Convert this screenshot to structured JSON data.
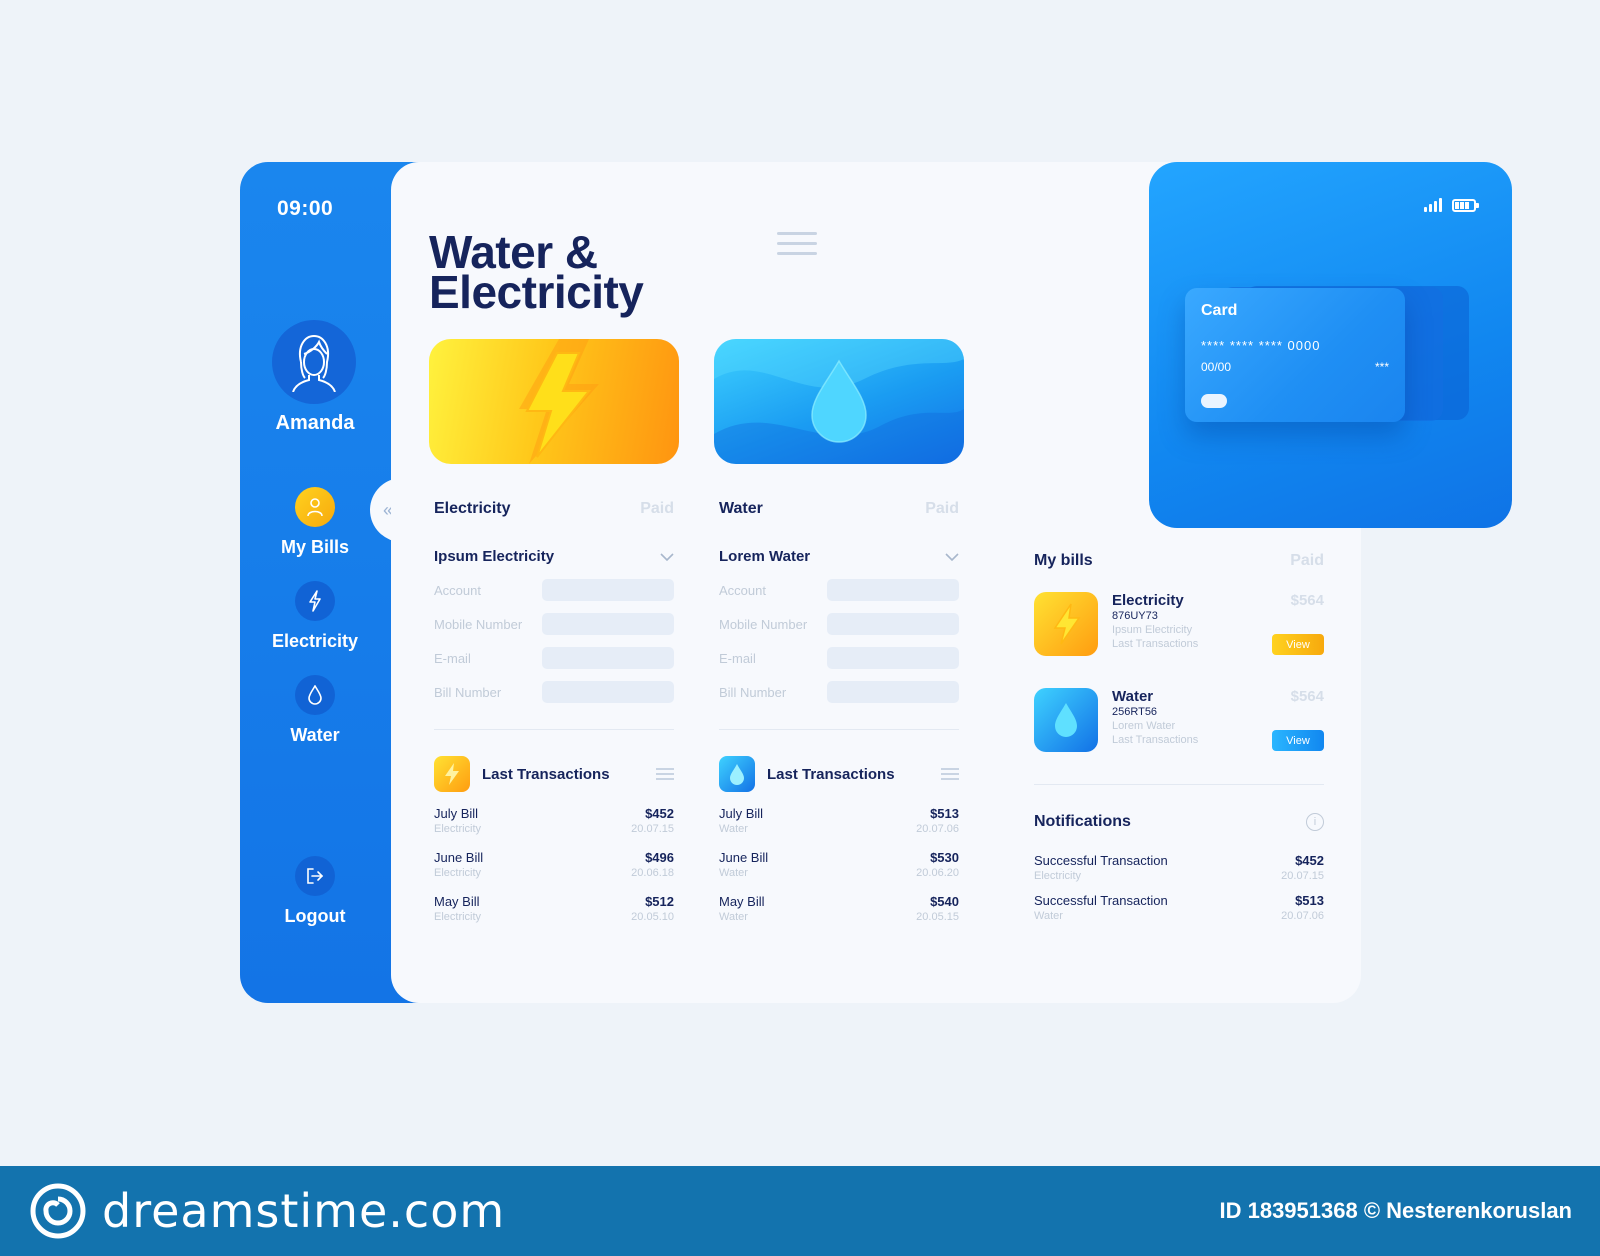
{
  "sidebar": {
    "time": "09:00",
    "user_name": "Amanda",
    "nav": [
      {
        "label": "My Bills"
      },
      {
        "label": "Electricity"
      },
      {
        "label": "Water"
      }
    ],
    "logout_label": "Logout",
    "collapse_glyph": "«"
  },
  "main": {
    "title_line1": "Water &",
    "title_line2": "Electricity",
    "services": [
      {
        "title": "Electricity",
        "status": "Paid",
        "provider": "Ipsum Electricity",
        "fields": [
          "Account",
          "Mobile Number",
          "E-mail",
          "Bill Number"
        ],
        "tx_title": "Last Transactions",
        "transactions": [
          {
            "name": "July Bill",
            "category": "Electricity",
            "amount": "$452",
            "date": "20.07.15"
          },
          {
            "name": "June Bill",
            "category": "Electricity",
            "amount": "$496",
            "date": "20.06.18"
          },
          {
            "name": "May Bill",
            "category": "Electricity",
            "amount": "$512",
            "date": "20.05.10"
          }
        ]
      },
      {
        "title": "Water",
        "status": "Paid",
        "provider": "Lorem Water",
        "fields": [
          "Account",
          "Mobile Number",
          "E-mail",
          "Bill Number"
        ],
        "tx_title": "Last Transactions",
        "transactions": [
          {
            "name": "July Bill",
            "category": "Water",
            "amount": "$513",
            "date": "20.07.06"
          },
          {
            "name": "June Bill",
            "category": "Water",
            "amount": "$530",
            "date": "20.06.20"
          },
          {
            "name": "May Bill",
            "category": "Water",
            "amount": "$540",
            "date": "20.05.15"
          }
        ]
      }
    ]
  },
  "card": {
    "label": "Card",
    "number": "****  ****  ****  0000",
    "expiry": "00/00",
    "cvv": "***"
  },
  "my_bills": {
    "title": "My bills",
    "status": "Paid",
    "items": [
      {
        "title": "Electricity",
        "id": "876UY73",
        "provider": "Ipsum Electricity",
        "sub": "Last Transactions",
        "amount": "$564",
        "button": "View"
      },
      {
        "title": "Water",
        "id": "256RT56",
        "provider": "Lorem Water",
        "sub": "Last Transactions",
        "amount": "$564",
        "button": "View"
      }
    ]
  },
  "notifications": {
    "title": "Notifications",
    "items": [
      {
        "name": "Successful Transaction",
        "category": "Electricity",
        "amount": "$452",
        "date": "20.07.15"
      },
      {
        "name": "Successful Transaction",
        "category": "Water",
        "amount": "$513",
        "date": "20.07.06"
      }
    ]
  },
  "footer": {
    "brand": "dreamstime.com",
    "credit": "ID 183951368 © Nesterenkoruslan"
  },
  "colors": {
    "primary_blue": "#1a86ee",
    "navy_text": "#16245c",
    "yellow_accent": "#ffc81a",
    "footer_blue": "#1373ae"
  }
}
